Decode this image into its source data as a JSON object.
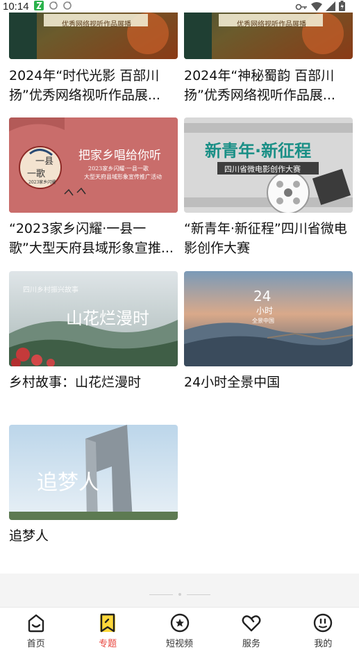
{
  "status_bar": {
    "time": "10:14",
    "icons": [
      "app-notification-icon",
      "sync-icon",
      "sync-icon",
      "key-icon",
      "wifi-icon",
      "signal-icon",
      "battery-icon"
    ]
  },
  "thumbs": {
    "top_left_banner": "优秀网络视听作品展播",
    "top_right_banner": "优秀网络视听作品展播",
    "hometown_title": "把家乡唱给你听",
    "hometown_sub1": "2023家乡闪耀·一县一歌",
    "hometown_sub2": "大型天府县域形象宣传推广活动",
    "hometown_badge1": "一县",
    "hometown_badge2": "一歌",
    "hometown_badge3": "2023家乡闪耀",
    "youth_title": "新青年·新征程",
    "youth_sub": "四川省微电影创作大赛",
    "flowers_title": "山花烂漫时",
    "flowers_top": "四川乡村振兴故事",
    "china24_num": "24",
    "china24_unit": "小时",
    "china24_sub": "全景中国",
    "dream_title": "追梦人"
  },
  "cards": [
    {
      "title": "2024年“时代光影 百部川扬”优秀网络视听作品展..."
    },
    {
      "title": "2024年“神秘蜀韵 百部川扬”优秀网络视听作品展..."
    },
    {
      "title": "“2023家乡闪耀·一县一歌”大型天府县域形象宣推..."
    },
    {
      "title": "“新青年·新征程”四川省微电影创作大赛"
    },
    {
      "title": "乡村故事：山花烂漫时"
    },
    {
      "title": "24小时全景中国"
    },
    {
      "title": "追梦人"
    }
  ],
  "nav": {
    "items": [
      {
        "label": "首页",
        "icon": "home-icon"
      },
      {
        "label": "专题",
        "icon": "bookmark-icon"
      },
      {
        "label": "短视频",
        "icon": "play-circle-icon"
      },
      {
        "label": "服务",
        "icon": "heart-icon"
      },
      {
        "label": "我的",
        "icon": "face-icon"
      }
    ],
    "active_index": 1,
    "active_color": "#e8433b"
  }
}
